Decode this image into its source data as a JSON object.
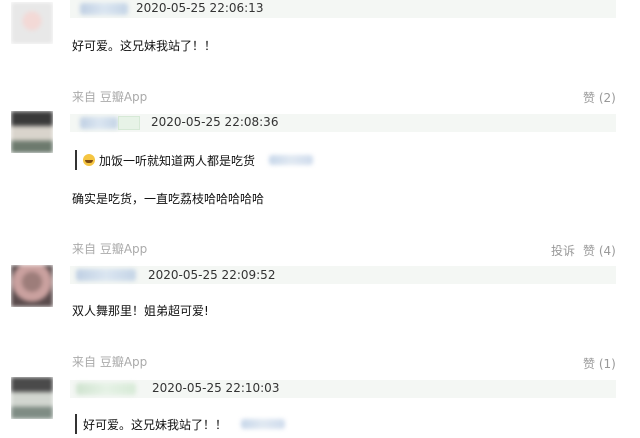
{
  "comments": [
    {
      "date": "2020-05-25 22:06:13",
      "text": "好可爱。这兄妹我站了！！"
    },
    {
      "source": "来自 豆瓣App",
      "likes": "赞 (2)"
    },
    {
      "date": "2020-05-25 22:08:36",
      "quote": "加饭一听就知道两人都是吃货",
      "text": "确实是吃货，一直吃荔枝哈哈哈哈哈"
    },
    {
      "source": "来自 豆瓣App",
      "report": "投诉",
      "likes": "赞 (4)"
    },
    {
      "date": "2020-05-25 22:09:52",
      "text": "双人舞那里！姐弟超可爱!"
    },
    {
      "source": "来自 豆瓣App",
      "likes": "赞 (1)"
    },
    {
      "date": "2020-05-25 22:10:03",
      "quote": "好可爱。这兄妹我站了！！"
    }
  ],
  "icons": {
    "emoji": "laughing-emoji-icon"
  },
  "colors": {
    "meta_bar": "#f4f7f4",
    "username_blur": "#c4d4e6",
    "muted": "#999999"
  }
}
